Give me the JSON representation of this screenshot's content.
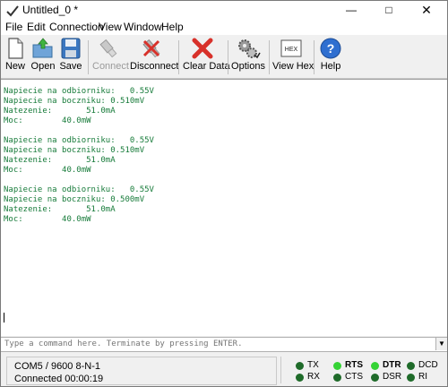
{
  "window": {
    "title": "Untitled_0 *"
  },
  "menu": [
    "File",
    "Edit",
    "Connection",
    "View",
    "Window",
    "Help"
  ],
  "toolbar": {
    "new": "New",
    "open": "Open",
    "save": "Save",
    "connect": "Connect",
    "disconnect": "Disconnect",
    "clear": "Clear Data",
    "options": "Options",
    "view_hex": "View Hex",
    "help": "Help",
    "hex_icon_text": "HEX"
  },
  "terminal": {
    "lines": [
      "Napiecie na odbiorniku:   0.55V",
      "Napiecie na boczniku: 0.510mV",
      "Natezenie:       51.0mA",
      "Moc:        40.0mW",
      "",
      "Napiecie na odbiorniku:   0.55V",
      "Napiecie na boczniku: 0.510mV",
      "Natezenie:       51.0mA",
      "Moc:        40.0mW",
      "",
      "Napiecie na odbiorniku:   0.55V",
      "Napiecie na boczniku: 0.500mV",
      "Natezenie:       51.0mA",
      "Moc:        40.0mW"
    ]
  },
  "command": {
    "placeholder": "Type a command here. Terminate by pressing ENTER."
  },
  "status": {
    "port": "COM5 / 9600 8-N-1",
    "connection": "Connected 00:00:19",
    "leds": {
      "tx": "TX",
      "rx": "RX",
      "rts": "RTS",
      "cts": "CTS",
      "dtr": "DTR",
      "dsr": "DSR",
      "dcd": "DCD",
      "ri": "RI"
    }
  },
  "colors": {
    "led_on": "#35d335",
    "led_off": "#1f6b2a",
    "terminal_text": "#177b3a"
  }
}
